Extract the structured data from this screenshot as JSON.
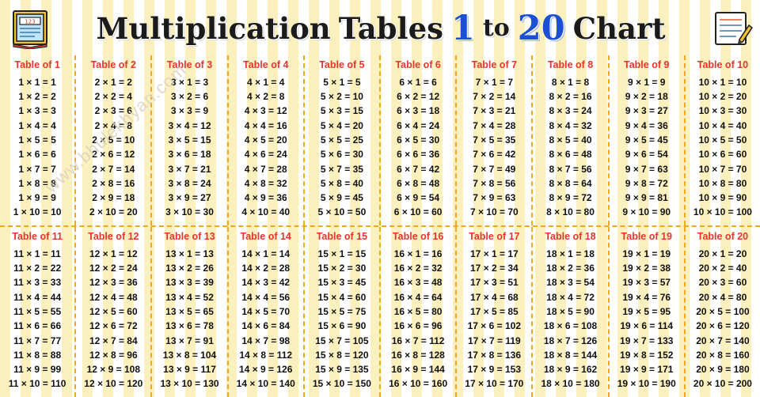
{
  "header": {
    "title_parts": [
      {
        "text": "Multiplication",
        "style": "word"
      },
      {
        "text": "Tables",
        "style": "word"
      },
      {
        "text": "1",
        "style": "number"
      },
      {
        "text": "to",
        "style": "small"
      },
      {
        "text": "20",
        "style": "number"
      },
      {
        "text": "Chart",
        "style": "word"
      }
    ],
    "left_icon": "book-icon",
    "right_icon": "notepad-pencil-icon"
  },
  "watermark": "www.bhulekhyan.com",
  "table_title_prefix": "Table of",
  "chart_data": {
    "type": "table",
    "title": "Multiplication Tables 1 to 20 Chart",
    "tables": [
      {
        "n": 1,
        "title": "Table of 1",
        "rows": [
          "1 × 1 = 1",
          "1 × 2 = 2",
          "1 × 3 = 3",
          "1 × 4 = 4",
          "1 × 5 = 5",
          "1 × 6 = 6",
          "1 × 7 = 7",
          "1 × 8 = 8",
          "1 × 9 = 9",
          "1 × 10 = 10"
        ]
      },
      {
        "n": 2,
        "title": "Table of 2",
        "rows": [
          "2 × 1 = 2",
          "2 × 2 = 4",
          "2 × 3 = 6",
          "2 × 4 = 8",
          "2 × 5 = 10",
          "2 × 6 = 12",
          "2 × 7 = 14",
          "2 × 8 = 16",
          "2 × 9 = 18",
          "2 × 10 = 20"
        ]
      },
      {
        "n": 3,
        "title": "Table of 3",
        "rows": [
          "3 × 1 = 3",
          "3 × 2 = 6",
          "3 × 3 = 9",
          "3 × 4 = 12",
          "3 × 5 = 15",
          "3 × 6 = 18",
          "3 × 7 = 21",
          "3 × 8 = 24",
          "3 × 9 = 27",
          "3 × 10 = 30"
        ]
      },
      {
        "n": 4,
        "title": "Table of 4",
        "rows": [
          "4 × 1 = 4",
          "4 × 2 = 8",
          "4 × 3 = 12",
          "4 × 4 = 16",
          "4 × 5 = 20",
          "4 × 6 = 24",
          "4 × 7 = 28",
          "4 × 8 = 32",
          "4 × 9 = 36",
          "4 × 10 = 40"
        ]
      },
      {
        "n": 5,
        "title": "Table of 5",
        "rows": [
          "5 × 1 = 5",
          "5 × 2 = 10",
          "5 × 3 = 15",
          "5 × 4 = 20",
          "5 × 5 = 25",
          "5 × 6 = 30",
          "5 × 7 = 35",
          "5 × 8 = 40",
          "5 × 9 = 45",
          "5 × 10 = 50"
        ]
      },
      {
        "n": 6,
        "title": "Table of 6",
        "rows": [
          "6 × 1 = 6",
          "6 × 2 = 12",
          "6 × 3 = 18",
          "6 × 4 = 24",
          "6 × 5 = 30",
          "6 × 6 = 36",
          "6 × 7 = 42",
          "6 × 8 = 48",
          "6 × 9 = 54",
          "6 × 10 = 60"
        ]
      },
      {
        "n": 7,
        "title": "Table of 7",
        "rows": [
          "7 × 1 = 7",
          "7 × 2 = 14",
          "7 × 3 = 21",
          "7 × 4 = 28",
          "7 × 5 = 35",
          "7 × 6 = 42",
          "7 × 7 = 49",
          "7 × 8 = 56",
          "7 × 9 = 63",
          "7 × 10 = 70"
        ]
      },
      {
        "n": 8,
        "title": "Table of 8",
        "rows": [
          "8 × 1 = 8",
          "8 × 2 = 16",
          "8 × 3 = 24",
          "8 × 4 = 32",
          "8 × 5 = 40",
          "8 × 6 = 48",
          "8 × 7 = 56",
          "8 × 8 = 64",
          "8 × 9 = 72",
          "8 × 10 = 80"
        ]
      },
      {
        "n": 9,
        "title": "Table of 9",
        "rows": [
          "9 × 1 = 9",
          "9 × 2 = 18",
          "9 × 3 = 27",
          "9 × 4 = 36",
          "9 × 5 = 45",
          "9 × 6 = 54",
          "9 × 7 = 63",
          "9 × 8 = 72",
          "9 × 9 = 81",
          "9 × 10 = 90"
        ]
      },
      {
        "n": 10,
        "title": "Table of 10",
        "rows": [
          "10 × 1 = 10",
          "10 × 2 = 20",
          "10 × 3 = 30",
          "10 × 4 = 40",
          "10 × 5 = 50",
          "10 × 6 = 60",
          "10 × 7 = 70",
          "10 × 8 = 80",
          "10 × 9 = 90",
          "10 × 10 = 100"
        ]
      },
      {
        "n": 11,
        "title": "Table of 11",
        "rows": [
          "11 × 1 = 11",
          "11 × 2 = 22",
          "11 × 3 = 33",
          "11 × 4 = 44",
          "11 × 5 = 55",
          "11 × 6 = 66",
          "11 × 7 = 77",
          "11 × 8 = 88",
          "11 × 9 = 99",
          "11 × 10 = 110"
        ]
      },
      {
        "n": 12,
        "title": "Table of 12",
        "rows": [
          "12 × 1 = 12",
          "12 × 2 = 24",
          "12 × 3 = 36",
          "12 × 4 = 48",
          "12 × 5 = 60",
          "12 × 6 = 72",
          "12 × 7 = 84",
          "12 × 8 = 96",
          "12 × 9 = 108",
          "12 × 10 = 120"
        ]
      },
      {
        "n": 13,
        "title": "Table of 13",
        "rows": [
          "13 × 1 = 13",
          "13 × 2 = 26",
          "13 × 3 = 39",
          "13 × 4 = 52",
          "13 × 5 = 65",
          "13 × 6 = 78",
          "13 × 7 = 91",
          "13 × 8 = 104",
          "13 × 9 = 117",
          "13 × 10 = 130"
        ]
      },
      {
        "n": 14,
        "title": "Table of 14",
        "rows": [
          "14 × 1 = 14",
          "14 × 2 = 28",
          "14 × 3 = 42",
          "14 × 4 = 56",
          "14 × 5 = 70",
          "14 × 6 = 84",
          "14 × 7 = 98",
          "14 × 8 = 112",
          "14 × 9 = 126",
          "14 × 10 = 140"
        ]
      },
      {
        "n": 15,
        "title": "Table of 15",
        "rows": [
          "15 × 1 = 15",
          "15 × 2 = 30",
          "15 × 3 = 45",
          "15 × 4 = 60",
          "15 × 5 = 75",
          "15 × 6 = 90",
          "15 × 7 = 105",
          "15 × 8 = 120",
          "15 × 9 = 135",
          "15 × 10 = 150"
        ]
      },
      {
        "n": 16,
        "title": "Table of 16",
        "rows": [
          "16 × 1 = 16",
          "16 × 2 = 32",
          "16 × 3 = 48",
          "16 × 4 = 64",
          "16 × 5 = 80",
          "16 × 6 = 96",
          "16 × 7 = 112",
          "16 × 8 = 128",
          "16 × 9 = 144",
          "16 × 10 = 160"
        ]
      },
      {
        "n": 17,
        "title": "Table of 17",
        "rows": [
          "17 × 1 = 17",
          "17 × 2 = 34",
          "17 × 3 = 51",
          "17 × 4 = 68",
          "17 × 5 = 85",
          "17 × 6 = 102",
          "17 × 7 = 119",
          "17 × 8 = 136",
          "17 × 9 = 153",
          "17 × 10 = 170"
        ]
      },
      {
        "n": 18,
        "title": "Table of 18",
        "rows": [
          "18 × 1 = 18",
          "18 × 2 = 36",
          "18 × 3 = 54",
          "18 × 4 = 72",
          "18 × 5 = 90",
          "18 × 6 = 108",
          "18 × 7 = 126",
          "18 × 8 = 144",
          "18 × 9 = 162",
          "18 × 10 = 180"
        ]
      },
      {
        "n": 19,
        "title": "Table of 19",
        "rows": [
          "19 × 1 = 19",
          "19 × 2 = 38",
          "19 × 3 = 57",
          "19 × 4 = 76",
          "19 × 5 = 95",
          "19 × 6 = 114",
          "19 × 7 = 133",
          "19 × 8 = 152",
          "19 × 9 = 171",
          "19 × 10 = 190"
        ]
      },
      {
        "n": 20,
        "title": "Table of 20",
        "rows": [
          "20 × 1 = 20",
          "20 × 2 = 40",
          "20 × 3 = 60",
          "20 × 4 = 80",
          "20 × 5 = 100",
          "20 × 6 = 120",
          "20 × 7 = 140",
          "20 × 8 = 160",
          "20 × 9 = 180",
          "20 × 10 = 200"
        ]
      }
    ]
  },
  "colors": {
    "stripe": "#fdf0bf",
    "title_text": "#1b1b1b",
    "title_number": "#1a4fd6",
    "table_heading": "#e8352b",
    "cell_text": "#111111",
    "divider": "#f0a81e"
  }
}
